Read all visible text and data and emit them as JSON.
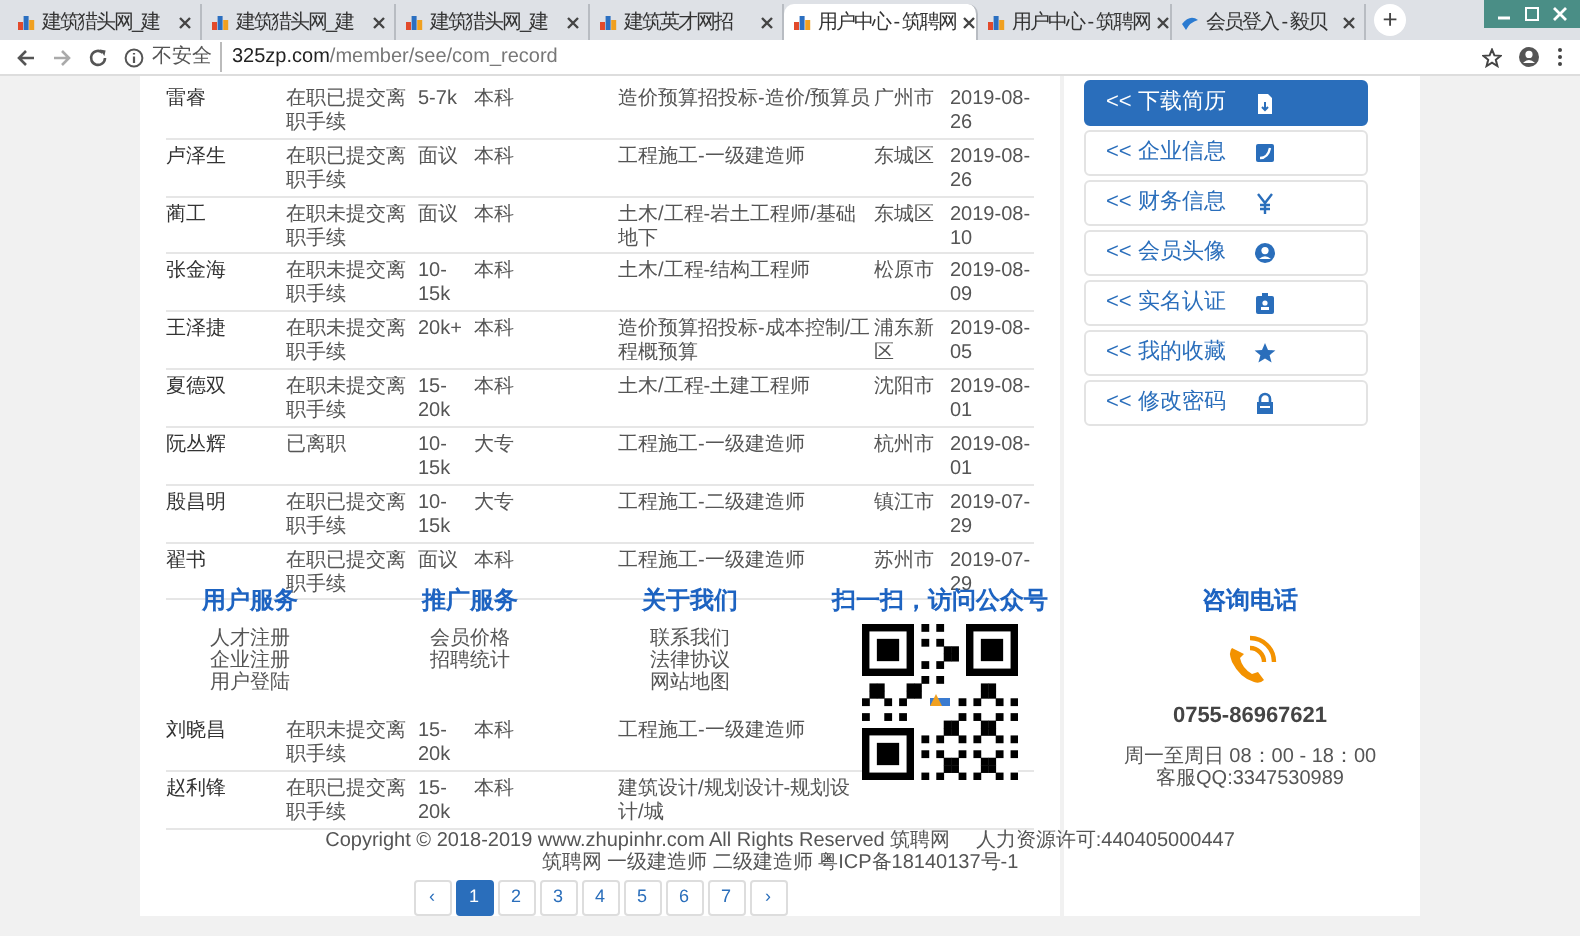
{
  "browser": {
    "tabs": [
      {
        "title": "建筑猎头网_建",
        "selected": false
      },
      {
        "title": "建筑猎头网_建",
        "selected": false
      },
      {
        "title": "建筑猎头网_建",
        "selected": false
      },
      {
        "title": "建筑英才网招",
        "selected": false
      },
      {
        "title": "用户中心 - 筑聘网",
        "selected": true
      },
      {
        "title": "用户中心 - 筑聘网",
        "selected": false
      },
      {
        "title": "会员登入 - 毅贝",
        "selected": false
      }
    ],
    "new_tab": "+",
    "security": "不安全",
    "url_domain": "325zp.com",
    "url_path": "/member/see/com_record"
  },
  "table": {
    "rows": [
      {
        "name": "雷睿",
        "status": "在职已提交离职手续",
        "salary": "5-7k",
        "education": "本科",
        "position": "造价预算招投标-造价/预算员",
        "city": "广州市",
        "date": "2019-08-26"
      },
      {
        "name": "卢泽生",
        "status": "在职已提交离职手续",
        "salary": "面议",
        "education": "本科",
        "position": "工程施工-一级建造师",
        "city": "东城区",
        "date": "2019-08-26"
      },
      {
        "name": "蔺工",
        "status": "在职未提交离职手续",
        "salary": "面议",
        "education": "本科",
        "position": "土木/工程-岩土工程师/基础地下",
        "city": "东城区",
        "date": "2019-08-10"
      },
      {
        "name": "张金海",
        "status": "在职未提交离职手续",
        "salary": "10-15k",
        "education": "本科",
        "position": "土木/工程-结构工程师",
        "city": "松原市",
        "date": "2019-08-09"
      },
      {
        "name": "王泽捷",
        "status": "在职未提交离职手续",
        "salary": "20k+",
        "education": "本科",
        "position": "造价预算招投标-成本控制/工程概预算",
        "city": "浦东新区",
        "date": "2019-08-05"
      },
      {
        "name": "夏德双",
        "status": "在职未提交离职手续",
        "salary": "15-20k",
        "education": "本科",
        "position": "土木/工程-土建工程师",
        "city": "沈阳市",
        "date": "2019-08-01"
      },
      {
        "name": "阮丛辉",
        "status": "已离职",
        "salary": "10-15k",
        "education": "大专",
        "position": "工程施工-一级建造师",
        "city": "杭州市",
        "date": "2019-08-01"
      },
      {
        "name": "殷昌明",
        "status": "在职已提交离职手续",
        "salary": "10-15k",
        "education": "大专",
        "position": "工程施工-二级建造师",
        "city": "镇江市",
        "date": "2019-07-29"
      },
      {
        "name": "翟书",
        "status": "在职已提交离职手续",
        "salary": "面议",
        "education": "本科",
        "position": "工程施工-一级建造师",
        "city": "苏州市",
        "date": "2019-07-29"
      }
    ]
  },
  "table_continued": {
    "rows": [
      {
        "name": "刘晓昌",
        "status": "在职未提交离职手续",
        "salary": "15-20k",
        "education": "本科",
        "position": "工程施工-一级建造师"
      },
      {
        "name": "赵利锋",
        "status": "在职已提交离职手续",
        "salary": "15-20k",
        "education": "本科",
        "position": "建筑设计/规划设计-规划设计/城"
      }
    ]
  },
  "pagination": [
    {
      "label": "‹",
      "selected": false
    },
    {
      "label": "1",
      "selected": true
    },
    {
      "label": "2",
      "selected": false
    },
    {
      "label": "3",
      "selected": false
    },
    {
      "label": "4",
      "selected": false
    },
    {
      "label": "5",
      "selected": false
    },
    {
      "label": "6",
      "selected": false
    },
    {
      "label": "7",
      "selected": false
    },
    {
      "label": "›",
      "selected": false
    }
  ],
  "sidebar": {
    "items": [
      {
        "label": "<< 下载简历",
        "selected": true
      },
      {
        "label": "<< 企业信息",
        "selected": false
      },
      {
        "label": "<< 财务信息",
        "selected": false
      },
      {
        "label": "<< 会员头像",
        "selected": false
      },
      {
        "label": "<< 实名认证",
        "selected": false
      },
      {
        "label": "<< 我的收藏",
        "selected": false
      },
      {
        "label": "<< 修改密码",
        "selected": false
      }
    ]
  },
  "footer": {
    "columns": [
      {
        "title": "用户服务",
        "links": [
          "人才注册",
          "企业注册",
          "用户登陆"
        ]
      },
      {
        "title": "推广服务",
        "links": [
          "会员价格",
          "招聘统计"
        ]
      },
      {
        "title": "关于我们",
        "links": [
          "联系我们",
          "法律协议",
          "网站地图"
        ]
      }
    ],
    "qr_title": "扫一扫，访问公众号",
    "contact": {
      "title": "咨询电话",
      "phone": "0755-86967621",
      "hours": "周一至周日 08：00 - 18：00",
      "qq": "客服QQ:3347530989"
    },
    "copyright": "Copyright © 2018-2019 www.zhupinhr.com All Rights Reserved 筑聘网　 人力资源许可:440405000447",
    "icp": "筑聘网 一级建造师 二级建造师 粤ICP备18140137号-1"
  }
}
